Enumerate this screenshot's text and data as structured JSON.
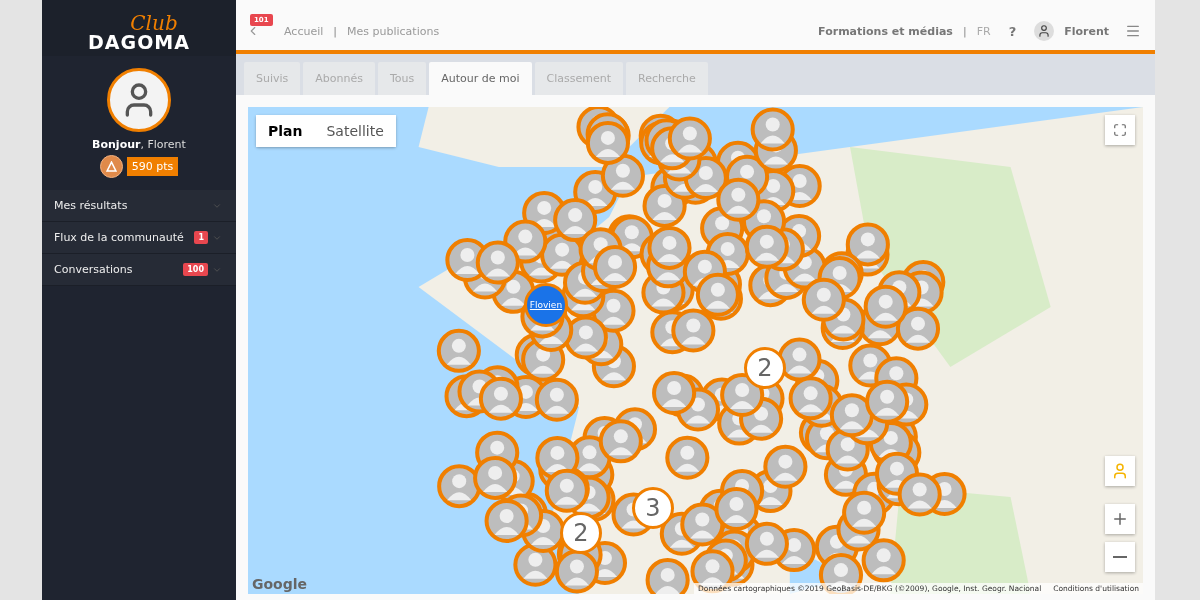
{
  "header": {
    "notification_badge": "101",
    "breadcrumbs": [
      "Accueil",
      "Mes publications"
    ],
    "breadcrumb_separator": "|",
    "link_separator": "|",
    "link": "Formations et médias",
    "language": "FR",
    "help": "?",
    "user": "Florent"
  },
  "sidebar": {
    "logo_script": "Club",
    "logo_word": "DAGOMA",
    "greeting": "**Bonjour**, Florent",
    "points": "590 pts",
    "menu": [
      {
        "label": "Mes résultats"
      },
      {
        "label": "Flux de la communauté",
        "badge": "1"
      },
      {
        "label": "Conversations",
        "badge": "100"
      }
    ]
  },
  "tabs": [
    {
      "label": "Suivis",
      "selected": false
    },
    {
      "label": "Abonnés",
      "selected": false
    },
    {
      "label": "Tous",
      "selected": false
    },
    {
      "label": "Autour de moi",
      "selected": true
    },
    {
      "label": "Classement",
      "selected": false
    },
    {
      "label": "Recherche",
      "selected": false
    }
  ],
  "map": {
    "types": [
      {
        "label": "Plan",
        "selected": true
      },
      {
        "label": "Satellite",
        "selected": false
      }
    ],
    "clusters": [
      "2",
      "3",
      "2"
    ],
    "marker_label": "Flovien",
    "logo": "Google",
    "attribution": "Données cartographiques ©2019 GeoBasis-DE/BKG (©2009), Google, Inst. Geogr. Nacional",
    "terms": "Conditions d'utilisation"
  }
}
